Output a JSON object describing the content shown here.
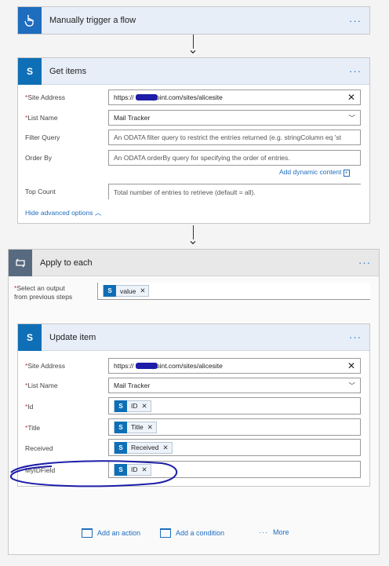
{
  "trigger": {
    "title": "Manually trigger a flow",
    "more": "···"
  },
  "get_items": {
    "title": "Get items",
    "more": "···",
    "site_label": "Site Address",
    "site_value": "https://     sharepoint.com/sites/alicesite",
    "list_label": "List Name",
    "list_value": "Mail Tracker",
    "filter_label": "Filter Query",
    "filter_placeholder": "An ODATA filter query to restrict the entries returned (e.g. stringColumn eq 'st",
    "order_label": "Order By",
    "order_placeholder": "An ODATA orderBy query for specifying the order of entries.",
    "add_dynamic": "Add dynamic content",
    "top_label": "Top Count",
    "top_placeholder": "Total number of entries to retrieve (default = all).",
    "hide_advanced": "Hide advanced options"
  },
  "apply_each": {
    "title": "Apply to each",
    "more": "···",
    "select_label_1": "Select an output",
    "select_label_2": "from previous steps",
    "token": "value"
  },
  "update_item": {
    "title": "Update item",
    "more": "···",
    "site_label": "Site Address",
    "site_value": "https://     sharepoint.com/sites/alicesite",
    "list_label": "List Name",
    "list_value": "Mail Tracker",
    "id_label": "Id",
    "id_token": "ID",
    "title_label": "Title",
    "title_token": "Title",
    "received_label": "Received",
    "received_token": "Received",
    "myid_label": "MyIDField",
    "myid_token": "ID"
  },
  "actions": {
    "add_action": "Add an action",
    "add_condition": "Add a condition",
    "more": "More"
  },
  "colors": {
    "trigger_blue": "#1e6dbf",
    "sharepoint": "#0f6fb6",
    "loop_gray": "#586a80",
    "annotation": "#1d1da8"
  }
}
